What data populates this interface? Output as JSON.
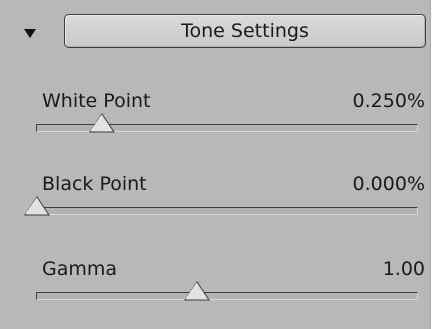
{
  "panel": {
    "section_title": "Tone Settings",
    "expanded": true
  },
  "params": [
    {
      "label": "White Point",
      "value": "0.250%",
      "slider_fraction": 0.17
    },
    {
      "label": "Black Point",
      "value": "0.000%",
      "slider_fraction": 0.0
    },
    {
      "label": "Gamma",
      "value": "1.00",
      "slider_fraction": 0.42
    }
  ],
  "icons": {
    "collapse": "triangle-down-icon",
    "thumb": "slider-thumb-triangle"
  },
  "colors": {
    "panel_bg": "#b8b8b8",
    "button_bg": "#d2d2d2",
    "text": "#1a1a1a",
    "track_shadow": "#3e3e3e"
  }
}
